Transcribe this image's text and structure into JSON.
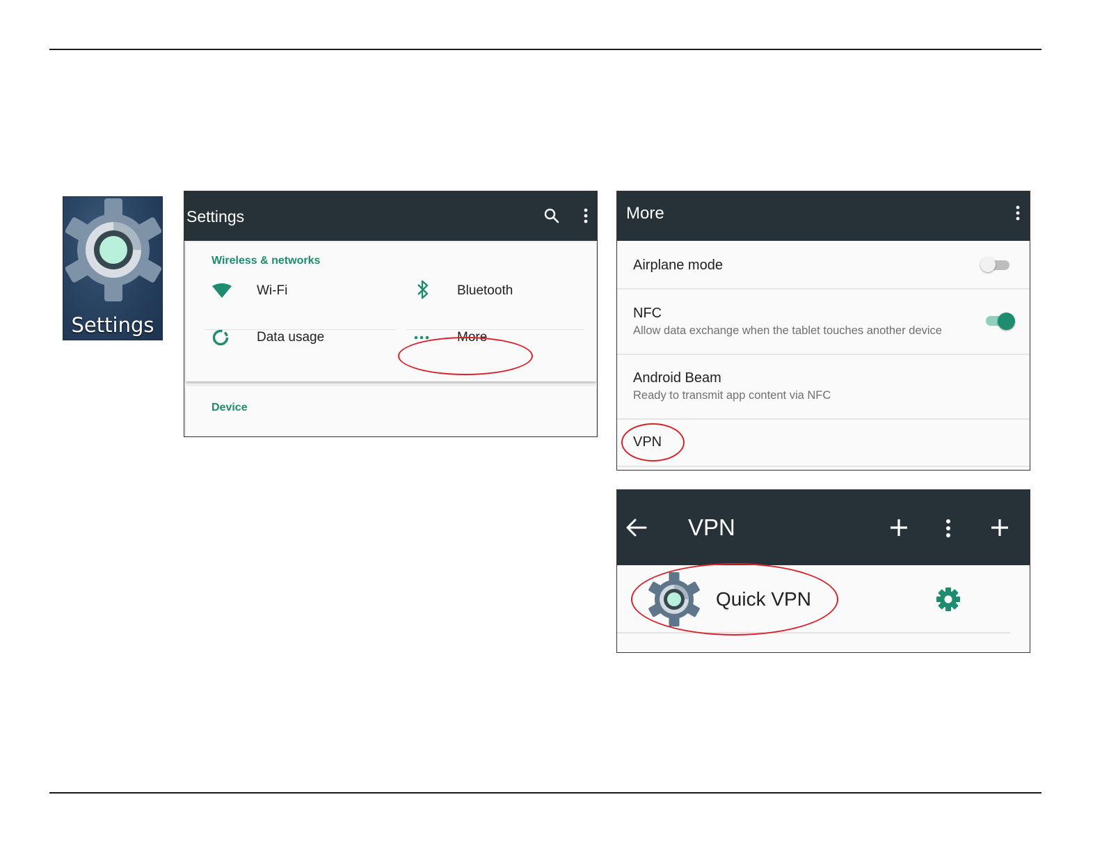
{
  "app_icon": {
    "label": "Settings",
    "icon": "settings-gear-icon"
  },
  "settings_screen": {
    "title": "Settings",
    "actions": [
      "search-icon",
      "overflow-menu-icon"
    ],
    "sections": [
      {
        "header": "Wireless & networks",
        "tiles": [
          {
            "label": "Wi-Fi",
            "icon": "wifi-icon"
          },
          {
            "label": "Bluetooth",
            "icon": "bluetooth-icon"
          },
          {
            "label": "Data usage",
            "icon": "data-usage-icon"
          },
          {
            "label": "More",
            "icon": "more-dots-icon",
            "highlighted": true
          }
        ]
      },
      {
        "header": "Device"
      }
    ],
    "accent_color": "#1e8c6e",
    "toolbar_color": "#263238"
  },
  "more_screen": {
    "title": "More",
    "rows": [
      {
        "title": "Airplane mode",
        "toggle": "off"
      },
      {
        "title": "NFC",
        "subtitle": "Allow data exchange when the tablet touches another device",
        "toggle": "on"
      },
      {
        "title": "Android Beam",
        "subtitle": "Ready to transmit app content via NFC"
      },
      {
        "title": "VPN",
        "highlighted": true
      }
    ]
  },
  "vpn_screen": {
    "title": "VPN",
    "actions": [
      "add-icon",
      "overflow-menu-icon",
      "add-icon"
    ],
    "profiles": [
      {
        "name": "Quick VPN",
        "icon": "settings-gear-icon",
        "action_icon": "gear-icon",
        "highlighted": true
      }
    ]
  },
  "callout_color": "#d8232a"
}
